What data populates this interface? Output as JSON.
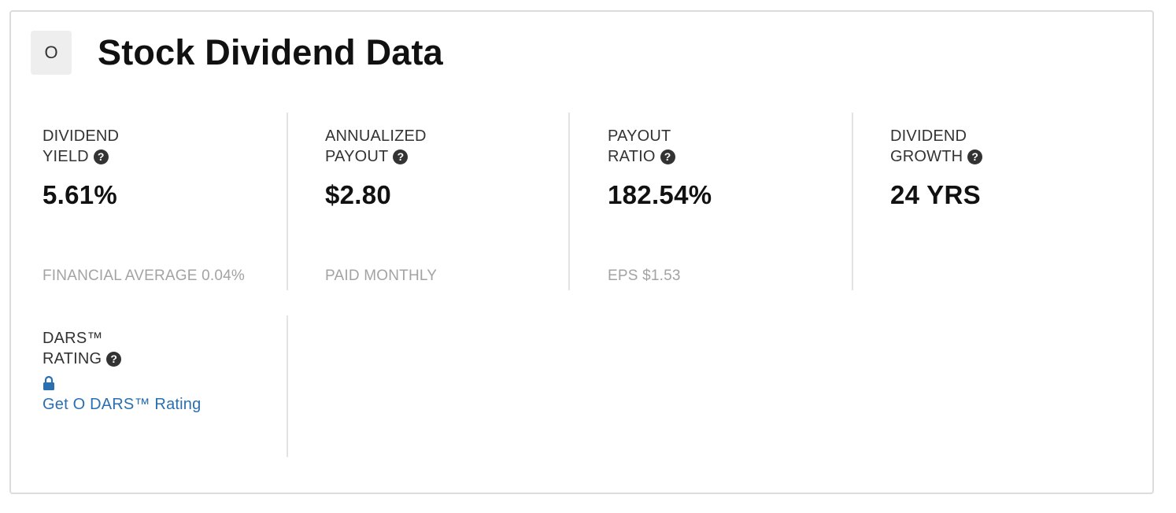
{
  "header": {
    "ticker": "O",
    "title": "Stock Dividend Data"
  },
  "metrics": [
    {
      "label_line1": "DIVIDEND",
      "label_line2": "YIELD",
      "value": "5.61%",
      "note": "FINANCIAL AVERAGE 0.04%"
    },
    {
      "label_line1": "ANNUALIZED",
      "label_line2": "PAYOUT",
      "value": "$2.80",
      "note": "PAID MONTHLY"
    },
    {
      "label_line1": "PAYOUT",
      "label_line2": "RATIO",
      "value": "182.54%",
      "note": "EPS $1.53"
    },
    {
      "label_line1": "DIVIDEND",
      "label_line2": "GROWTH",
      "value": "24 YRS",
      "note": ""
    }
  ],
  "dars": {
    "label_line1": "DARS™",
    "label_line2": "RATING",
    "link_text": "Get O DARS™ Rating"
  },
  "icons": {
    "help": "question-circle-icon",
    "lock": "lock-icon"
  },
  "colors": {
    "link": "#2a6fb0",
    "note": "#a3a3a3",
    "divider": "#e3e3e3"
  }
}
